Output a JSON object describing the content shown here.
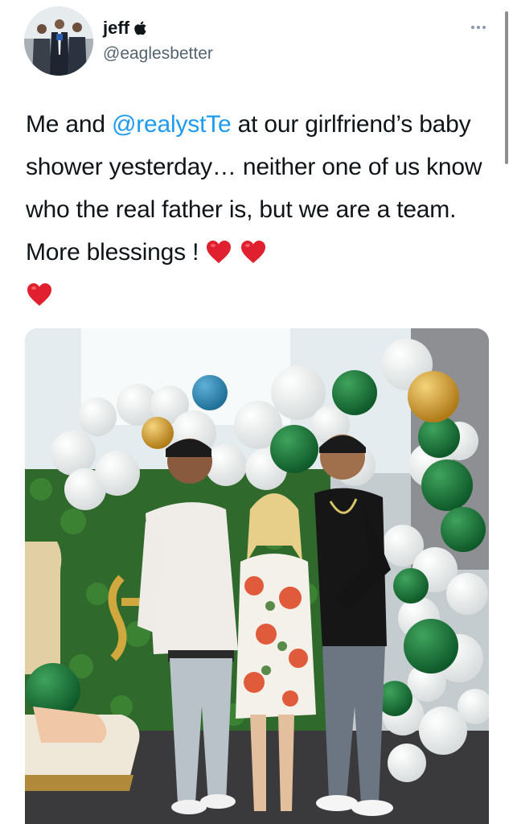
{
  "tweet": {
    "display_name": "jeff",
    "verified_badge_icon": "apple-logo-icon",
    "username": "@eaglesbetter",
    "more_icon": "ellipsis-icon",
    "text": {
      "part1": "Me and ",
      "mention": "@realystTe",
      "part2": " at our girlfriend’s baby shower yesterday… neither one of us know who the real father is, but we are a team. More blessings ! ",
      "emoji": [
        "heart-icon",
        "heart-icon",
        "heart-icon"
      ]
    },
    "media": {
      "type": "photo"
    }
  },
  "colors": {
    "accent": "#1d9bf0",
    "text_primary": "#0f1419",
    "text_secondary": "#536471",
    "heart": "#e0202e"
  }
}
